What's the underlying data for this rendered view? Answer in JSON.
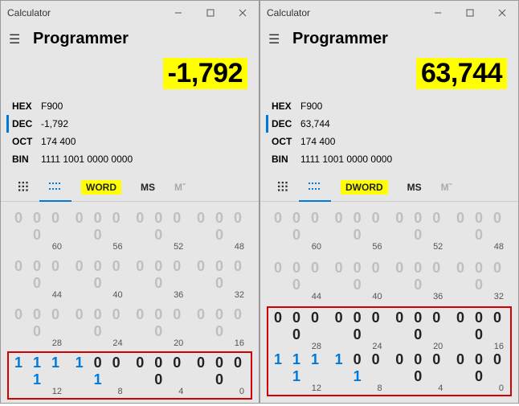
{
  "left": {
    "window_title": "Calculator",
    "mode": "Programmer",
    "result": "-1,792",
    "bases": {
      "hex_label": "HEX",
      "hex_val": "F900",
      "dec_label": "DEC",
      "dec_val": "-1,792",
      "oct_label": "OCT",
      "oct_val": "174 400",
      "bin_label": "BIN",
      "bin_val": "1111 1001 0000 0000"
    },
    "toolbar": {
      "word_label": "WORD",
      "ms_label": "MS",
      "mrec_label": "Mˇ"
    },
    "bit_rows": [
      {
        "active": false,
        "hl": false,
        "nibbles": [
          "0000",
          "0000",
          "0000",
          "0000"
        ],
        "idx": [
          "60",
          "56",
          "52",
          "48"
        ]
      },
      {
        "active": false,
        "hl": false,
        "nibbles": [
          "0000",
          "0000",
          "0000",
          "0000"
        ],
        "idx": [
          "44",
          "40",
          "36",
          "32"
        ]
      },
      {
        "active": false,
        "hl": false,
        "nibbles": [
          "0000",
          "0000",
          "0000",
          "0000"
        ],
        "idx": [
          "28",
          "24",
          "20",
          "16"
        ]
      },
      {
        "active": true,
        "hl": true,
        "nibbles": [
          "1111",
          "1001",
          "0000",
          "0000"
        ],
        "idx": [
          "12",
          "8",
          "4",
          "0"
        ]
      }
    ],
    "hl_group": "last1"
  },
  "right": {
    "window_title": "Calculator",
    "mode": "Programmer",
    "result": "63,744",
    "bases": {
      "hex_label": "HEX",
      "hex_val": "F900",
      "dec_label": "DEC",
      "dec_val": "63,744",
      "oct_label": "OCT",
      "oct_val": "174 400",
      "bin_label": "BIN",
      "bin_val": "1111 1001 0000 0000"
    },
    "toolbar": {
      "word_label": "DWORD",
      "ms_label": "MS",
      "mrec_label": "Mˇ"
    },
    "bit_rows": [
      {
        "active": false,
        "hl": false,
        "nibbles": [
          "0000",
          "0000",
          "0000",
          "0000"
        ],
        "idx": [
          "60",
          "56",
          "52",
          "48"
        ]
      },
      {
        "active": false,
        "hl": false,
        "nibbles": [
          "0000",
          "0000",
          "0000",
          "0000"
        ],
        "idx": [
          "44",
          "40",
          "36",
          "32"
        ]
      },
      {
        "active": true,
        "hl": true,
        "nibbles": [
          "0000",
          "0000",
          "0000",
          "0000"
        ],
        "idx": [
          "28",
          "24",
          "20",
          "16"
        ]
      },
      {
        "active": true,
        "hl": true,
        "nibbles": [
          "1111",
          "1001",
          "0000",
          "0000"
        ],
        "idx": [
          "12",
          "8",
          "4",
          "0"
        ]
      }
    ],
    "hl_group": "last2"
  }
}
